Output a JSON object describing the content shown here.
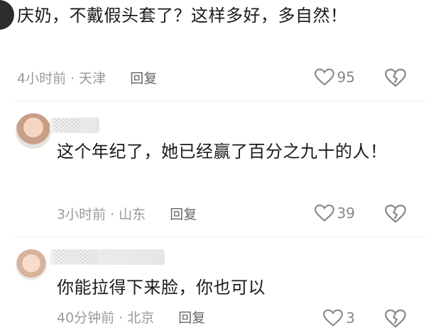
{
  "comments": [
    {
      "text": "庆奶，不戴假头套了？这样多好，多自然！",
      "time": "4小时前",
      "location": "天津",
      "reply_label": "回复",
      "likes": "95"
    },
    {
      "username": "░░░",
      "text": "这个年纪了，她已经赢了百分之九十的人！",
      "time": "3小时前",
      "location": "山东",
      "reply_label": "回复",
      "likes": "39"
    },
    {
      "username": "░░░░░",
      "text": "你能拉得下来脸，你也可以",
      "time": "40分钟前",
      "location": "北京",
      "reply_label": "回复",
      "likes": "3"
    }
  ],
  "colors": {
    "meta": "#9a9a9a",
    "text": "#1a1a1a",
    "icon": "#888888"
  },
  "icons": {
    "like": "heart-outline",
    "dislike": "broken-heart-outline"
  }
}
